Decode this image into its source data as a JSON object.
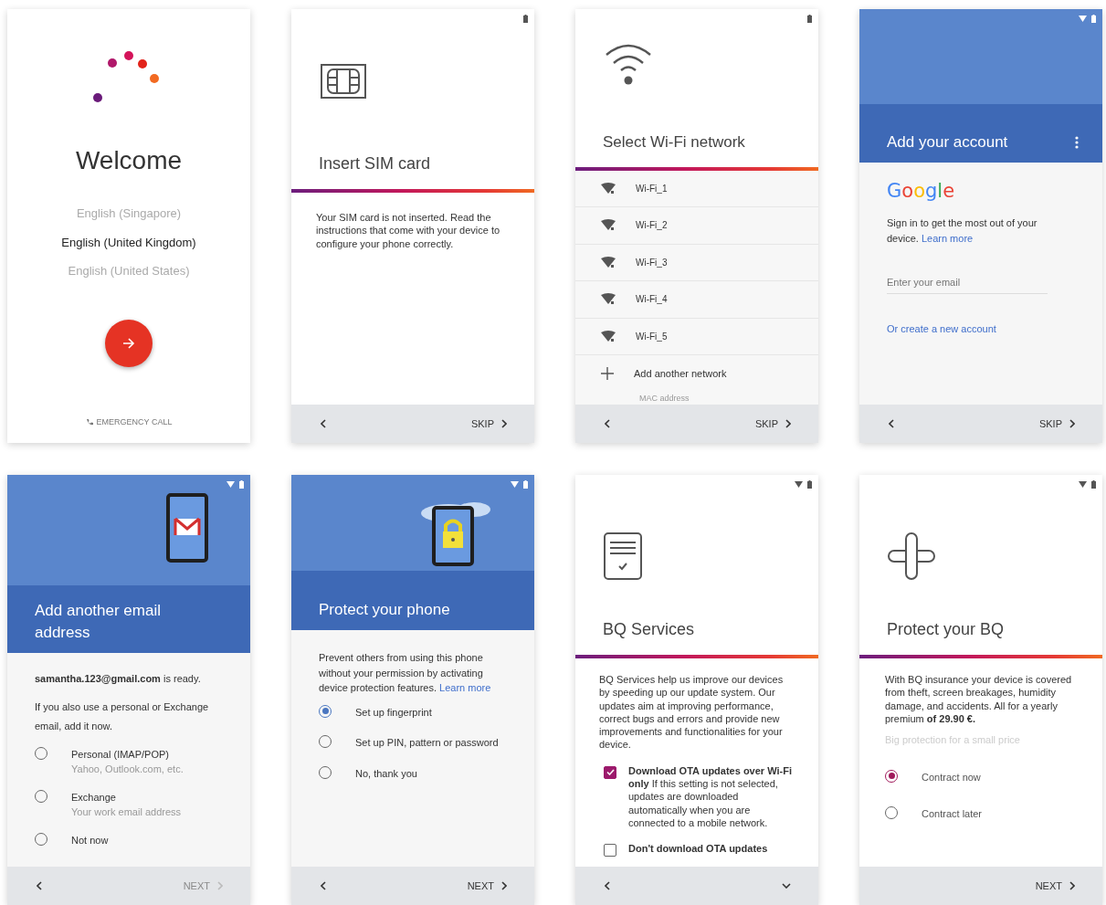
{
  "screens": [
    {
      "kind": "welcome",
      "title": "Welcome",
      "languages": [
        {
          "label": "English (Singapore)",
          "selected": false
        },
        {
          "label": "English (United Kingdom)",
          "selected": true
        },
        {
          "label": "English (United States)",
          "selected": false
        }
      ],
      "emergency": "EMERGENCY CALL"
    },
    {
      "kind": "sim",
      "status_bar": {
        "wifi": false
      },
      "title": "Insert SIM card",
      "body": "Your SIM card is not inserted. Read the instructions that come with your device to configure your phone correctly.",
      "footer": {
        "back": true,
        "next": "SKIP",
        "disabled": false
      }
    },
    {
      "kind": "wifi",
      "status_bar": {
        "wifi": false
      },
      "title": "Select Wi-Fi network",
      "networks": [
        "Wi-Fi_1",
        "Wi-Fi_2",
        "Wi-Fi_3",
        "Wi-Fi_4",
        "Wi-Fi_5"
      ],
      "add": "Add another network",
      "mac": "MAC address",
      "footer": {
        "back": true,
        "next": "SKIP",
        "disabled": false
      }
    },
    {
      "kind": "account",
      "status_bar": {
        "wifi": true
      },
      "title": "Add your account",
      "logo": "Google",
      "body": "Sign in to get the most out of your device.",
      "link": "Learn more",
      "placeholder": "Enter your email",
      "create": "Or create a new account",
      "footer": {
        "back": true,
        "next": "SKIP",
        "disabled": false
      }
    },
    {
      "kind": "email",
      "status_bar": {
        "wifi": true
      },
      "title": "Add another email address",
      "ready": "**samantha.123@gmail.com** is ready.",
      "body": "If you also use a personal or Exchange email, add it now.",
      "options": [
        {
          "label": "Personal (IMAP/POP)",
          "sub": "Yahoo, Outlook.com, etc.",
          "selected": false
        },
        {
          "label": "Exchange",
          "sub": "Your work email address",
          "selected": false
        },
        {
          "label": "Not now",
          "selected": false
        }
      ],
      "footer": {
        "back": true,
        "next": "NEXT",
        "disabled": true
      }
    },
    {
      "kind": "protect",
      "status_bar": {
        "wifi": true
      },
      "title": "Protect your phone",
      "body": "Prevent others from using this phone without your permission by activating device protection features.",
      "link": "Learn more",
      "options": [
        {
          "label": "Set up fingerprint",
          "selected": true
        },
        {
          "label": "Set up PIN, pattern or password",
          "selected": false
        },
        {
          "label": "No, thank you",
          "selected": false
        }
      ],
      "footer": {
        "back": true,
        "next": "NEXT",
        "disabled": false
      }
    },
    {
      "kind": "services",
      "status_bar": {
        "wifi": true
      },
      "title": "BQ Services",
      "body": "BQ Services help us improve our devices by speeding up our update system. Our updates aim at improving performance, correct bugs and errors and provide new improvements and functionalities for your device.",
      "checks": [
        {
          "text": "**Download OTA updates over Wi-Fi only** If this setting is not selected, updates are downloaded automatically when you are connected to a mobile network.",
          "checked": true
        },
        {
          "text": "**Don't download OTA updates**",
          "checked": false
        }
      ],
      "footer": {
        "back": true,
        "scroll": true
      }
    },
    {
      "kind": "insurance",
      "status_bar": {
        "wifi": true
      },
      "title": "Protect your BQ",
      "body": "With BQ insurance your device is covered from theft, screen breakages, humidity damage, and accidents. All for a yearly premium **of 29.90 €.**",
      "tagline": "Big protection for a small price",
      "options": [
        {
          "label": "Contract now",
          "selected": true
        },
        {
          "label": "Contract later",
          "selected": false
        }
      ],
      "footer": {
        "back": false,
        "next": "NEXT",
        "disabled": false
      }
    }
  ]
}
